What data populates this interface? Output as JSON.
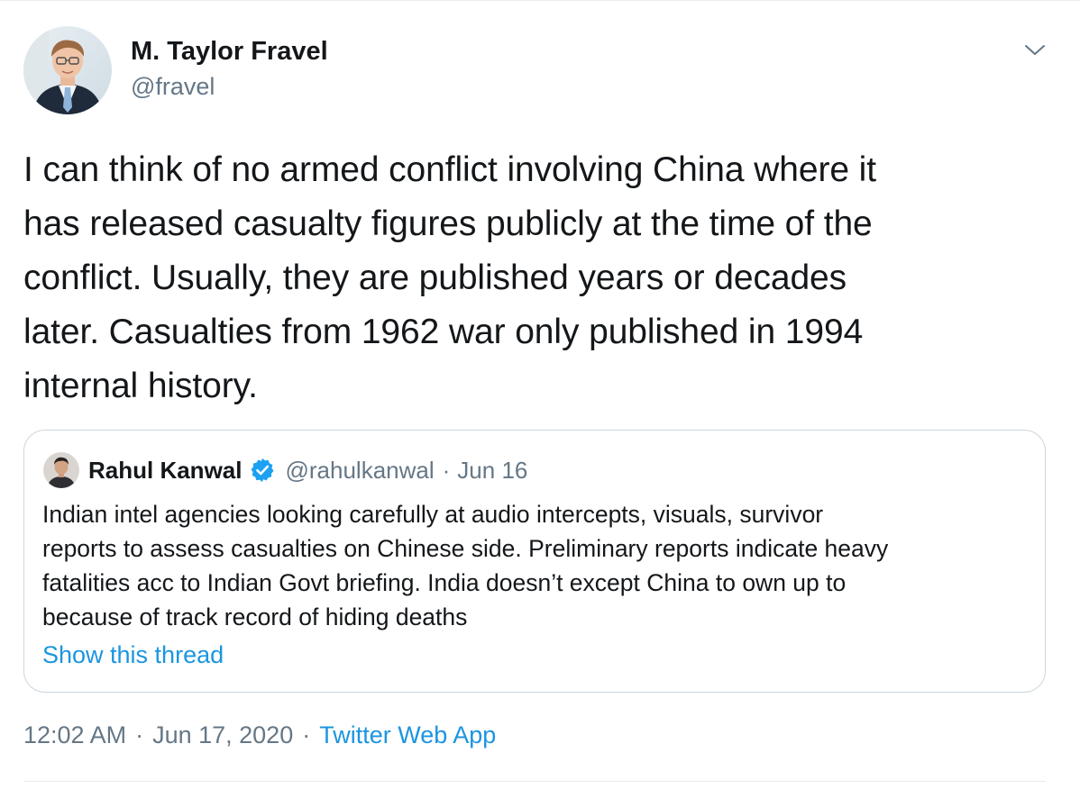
{
  "tweet": {
    "author_name": "M. Taylor Fravel",
    "author_handle": "@fravel",
    "text": "I can think of no armed conflict involving China where it\nhas released casualty figures publicly at the time of the\nconflict.  Usually, they are published years or decades\nlater.  Casualties from 1962 war only published in 1994\ninternal history.",
    "time": "12:02 AM",
    "date": "Jun 17, 2020",
    "source": "Twitter Web App",
    "separator": "·",
    "menu_icon": "chevron-down-icon"
  },
  "quote": {
    "author_name": "Rahul Kanwal",
    "author_handle": "@rahulkanwal",
    "separator": "·",
    "date": "Jun 16",
    "verified_icon": "verified-badge-icon",
    "text": "Indian intel agencies looking carefully at audio intercepts, visuals, survivor\nreports to assess casualties on Chinese side. Preliminary reports indicate heavy\nfatalities acc to Indian Govt briefing. India doesn’t except China to own up to\nbecause of track record of hiding deaths",
    "show_thread": "Show this thread"
  },
  "colors": {
    "text_primary": "#14171a",
    "text_secondary": "#657786",
    "link": "#1b95e0",
    "border": "#ccd6dd",
    "verified": "#1da1f2"
  }
}
